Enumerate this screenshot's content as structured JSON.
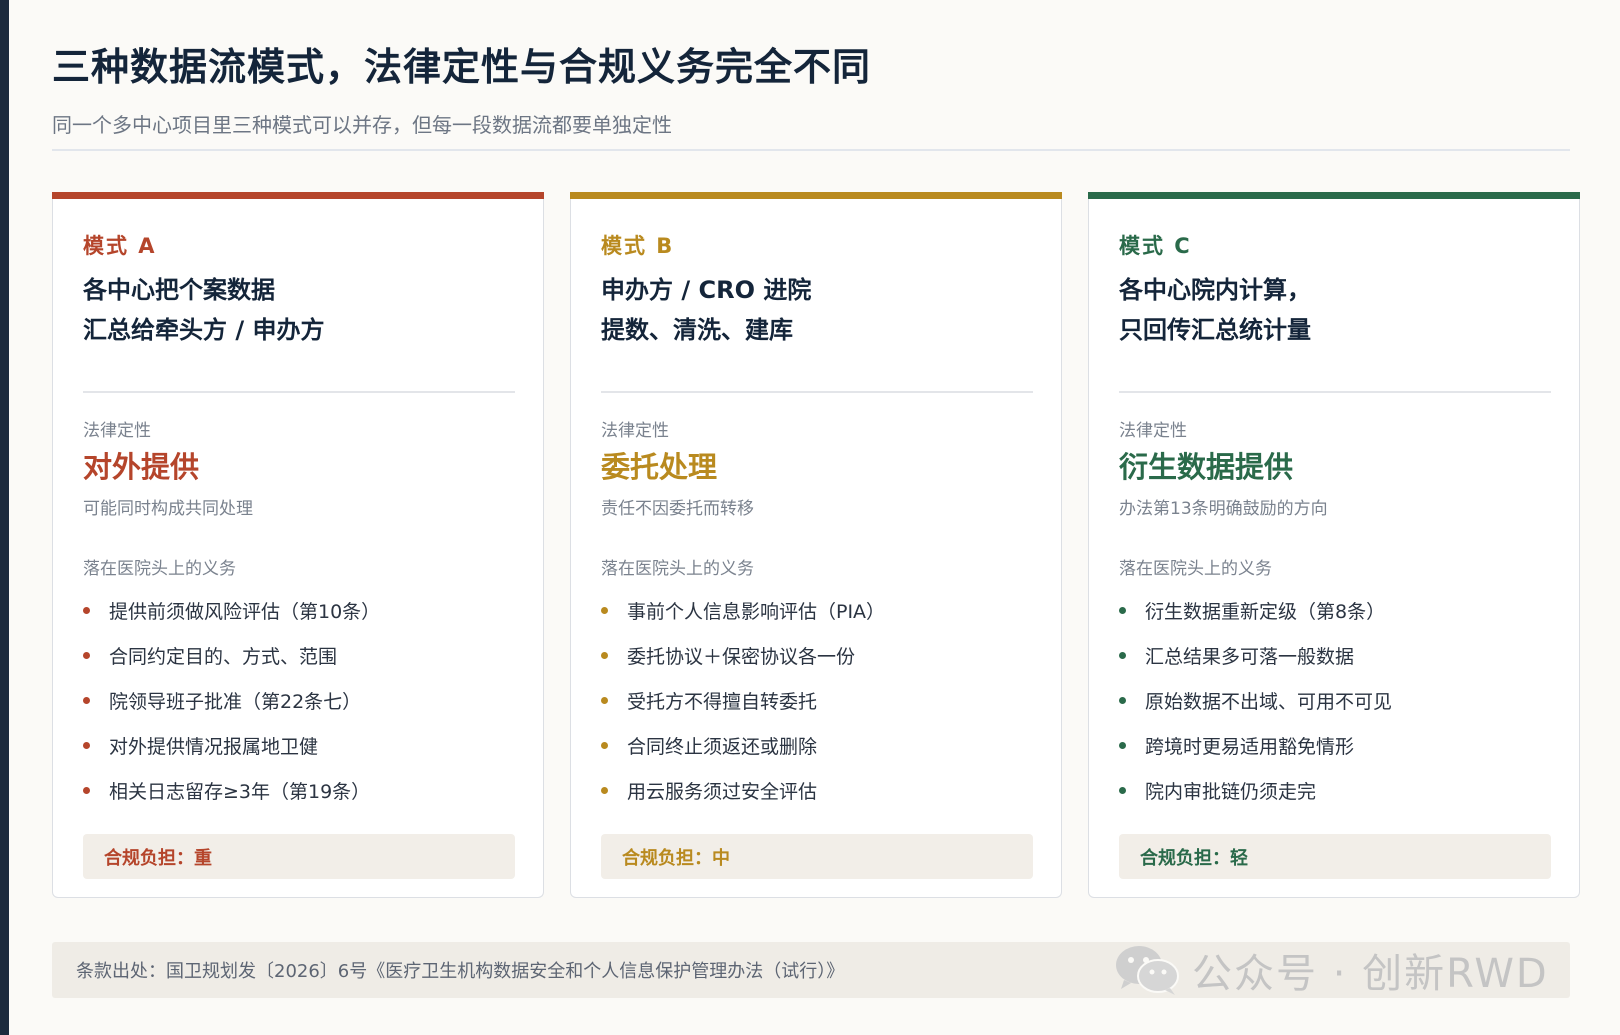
{
  "header": {
    "title": "三种数据流模式，法律定性与合规义务完全不同",
    "subtitle": "同一个多中心项目里三种模式可以并存，但每一段数据流都要单独定性"
  },
  "cards": [
    {
      "color": "#b5452b",
      "mode_label": "模式 A",
      "headline_line1": "各中心把个案数据",
      "headline_line2": "汇总给牵头方 / 申办方",
      "legal_caption": "法律定性",
      "legal_value": "对外提供",
      "legal_note": "可能同时构成共同处理",
      "duties_caption": "落在医院头上的义务",
      "duties": [
        "提供前须做风险评估（第10条）",
        "合同约定目的、方式、范围",
        "院领导班子批准（第22条七）",
        "对外提供情况报属地卫健",
        "相关日志留存≥3年（第19条）"
      ],
      "burden": "合规负担：重"
    },
    {
      "color": "#b98a1f",
      "mode_label": "模式 B",
      "headline_line1": "申办方 / CRO 进院",
      "headline_line2": "提数、清洗、建库",
      "legal_caption": "法律定性",
      "legal_value": "委托处理",
      "legal_note": "责任不因委托而转移",
      "duties_caption": "落在医院头上的义务",
      "duties": [
        "事前个人信息影响评估（PIA）",
        "委托协议＋保密协议各一份",
        "受托方不得擅自转委托",
        "合同终止须返还或删除",
        "用云服务须过安全评估"
      ],
      "burden": "合规负担：中"
    },
    {
      "color": "#2a6a4a",
      "mode_label": "模式 C",
      "headline_line1": "各中心院内计算，",
      "headline_line2": "只回传汇总统计量",
      "legal_caption": "法律定性",
      "legal_value": "衍生数据提供",
      "legal_note": "办法第13条明确鼓励的方向",
      "duties_caption": "落在医院头上的义务",
      "duties": [
        "衍生数据重新定级（第8条）",
        "汇总结果多可落一般数据",
        "原始数据不出域、可用不可见",
        "跨境时更易适用豁免情形",
        "院内审批链仍须走完"
      ],
      "burden": "合规负担：轻"
    }
  ],
  "footer": {
    "source": "条款出处：国卫规划发〔2026〕6号《医疗卫生机构数据安全和个人信息保护管理办法（试行）》"
  },
  "watermark": {
    "icon": "wechat-icon",
    "text": "公众号 · 创新RWD"
  }
}
